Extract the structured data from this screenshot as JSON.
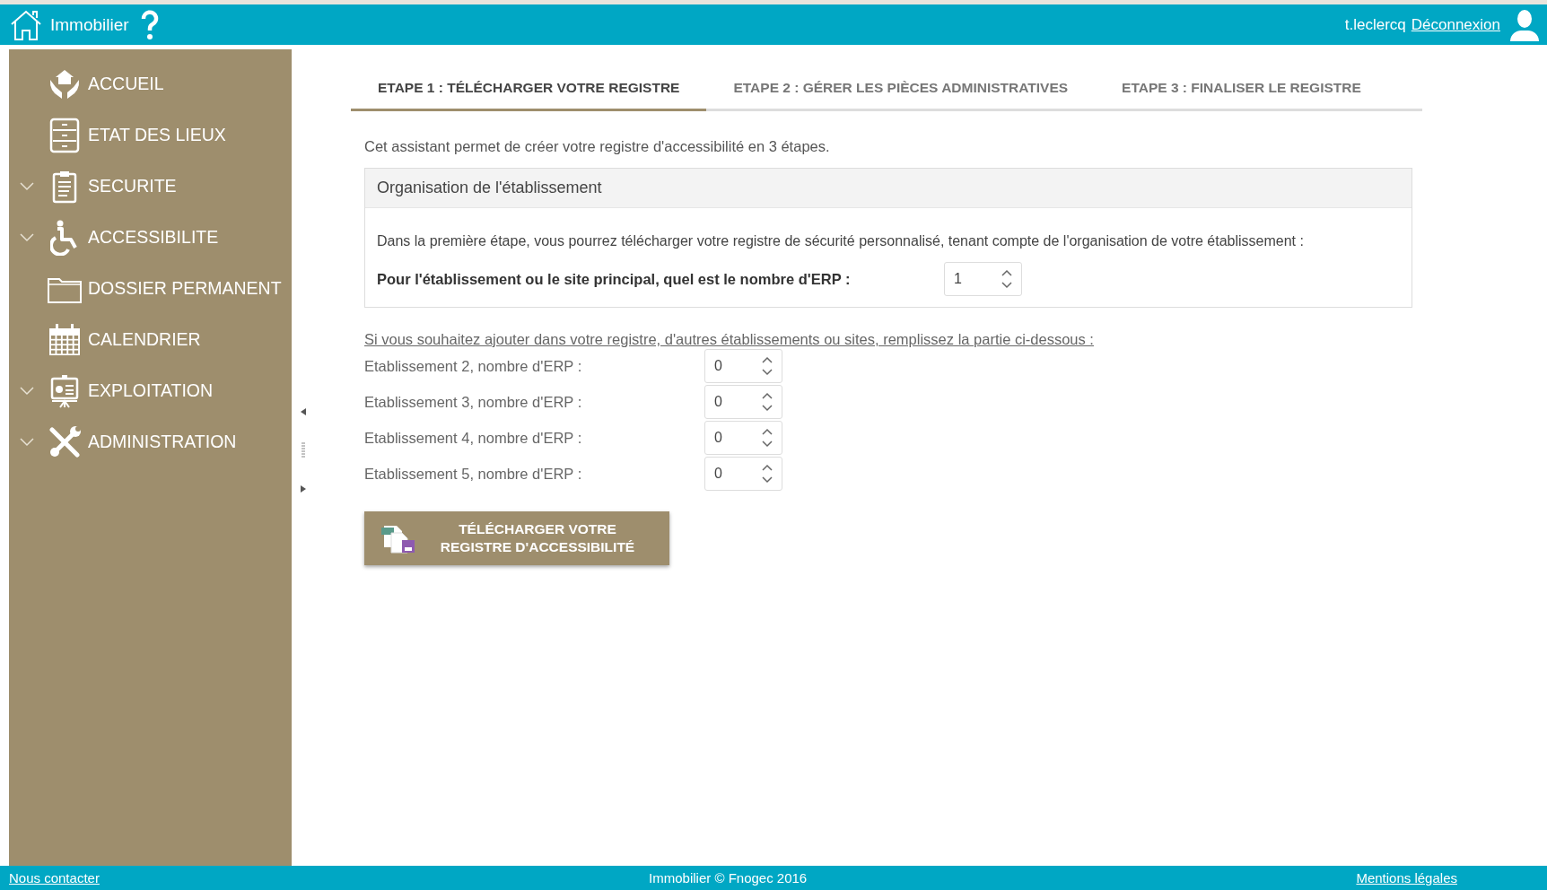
{
  "header": {
    "app_name": "Immobilier",
    "username": "t.leclercq",
    "logout": "Déconnexion"
  },
  "sidebar": {
    "items": [
      {
        "label": "ACCUEIL",
        "expandable": false
      },
      {
        "label": "ETAT DES LIEUX",
        "expandable": false
      },
      {
        "label": "SECURITE",
        "expandable": true
      },
      {
        "label": "ACCESSIBILITE",
        "expandable": true
      },
      {
        "label": "DOSSIER PERMANENT",
        "expandable": false
      },
      {
        "label": "CALENDRIER",
        "expandable": false
      },
      {
        "label": "EXPLOITATION",
        "expandable": true
      },
      {
        "label": "ADMINISTRATION",
        "expandable": true
      }
    ]
  },
  "tabs": [
    {
      "label": "ETAPE 1 : TÉLÉCHARGER VOTRE REGISTRE",
      "selected": true
    },
    {
      "label": "ETAPE 2 : GÉRER LES PIÈCES ADMINISTRATIVES",
      "selected": false
    },
    {
      "label": "ETAPE 3 : FINALISER LE REGISTRE",
      "selected": false
    }
  ],
  "intro": "Cet assistant permet de créer votre registre d'accessibilité en 3 étapes.",
  "panel": {
    "title": "Organisation de l'établissement",
    "description": "Dans la première étape, vous pourrez télécharger votre registre de sécurité personnalisé, tenant compte de l'organisation de votre établissement :",
    "question": "Pour l'établissement ou le site principal, quel est le nombre d'ERP :",
    "value": "1"
  },
  "additional_link": "Si vous souhaitez ajouter dans votre registre, d'autres établissements ou sites, remplissez la partie ci-dessous :",
  "establishments": [
    {
      "label": "Etablissement 2, nombre d'ERP :",
      "value": "0"
    },
    {
      "label": "Etablissement 3, nombre d'ERP :",
      "value": "0"
    },
    {
      "label": "Etablissement 4, nombre d'ERP :",
      "value": "0"
    },
    {
      "label": "Etablissement 5, nombre d'ERP :",
      "value": "0"
    }
  ],
  "download_button": "TÉLÉCHARGER VOTRE REGISTRE D'ACCESSIBILITÉ",
  "footer": {
    "contact": "Nous contacter",
    "copyright": "Immobilier © Fnogec 2016",
    "legal": "Mentions légales"
  }
}
